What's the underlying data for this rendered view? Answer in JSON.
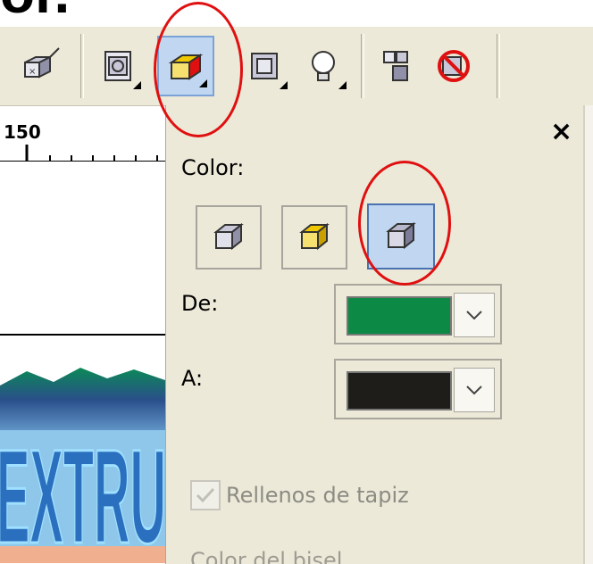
{
  "header": {
    "title_fragment": "or."
  },
  "ruler": {
    "label": "150"
  },
  "canvas": {
    "artwork_text": "EXTRU"
  },
  "toolbar": {
    "buttons": [
      {
        "name": "extrude-vanishing-point",
        "icon": "cube-vanishing-point-icon"
      },
      {
        "name": "extrude-rotation",
        "icon": "cube-rotation-icon"
      },
      {
        "name": "extrude-color",
        "icon": "cube-color-icon",
        "active": true
      },
      {
        "name": "extrude-bevel",
        "icon": "cube-bevel-icon"
      },
      {
        "name": "extrude-lighting",
        "icon": "lightbulb-icon"
      },
      {
        "name": "copy-extrude-properties",
        "icon": "copy-properties-icon"
      },
      {
        "name": "clear-extrude",
        "icon": "clear-extrude-icon"
      }
    ]
  },
  "panel": {
    "close_label": "×",
    "color_label": "Color:",
    "color_modes": [
      {
        "name": "object-fill",
        "icon": "cube-object-fill-icon"
      },
      {
        "name": "solid-fill",
        "icon": "cube-solid-fill-icon"
      },
      {
        "name": "shade",
        "icon": "cube-shade-icon",
        "selected": true
      }
    ],
    "from_label": "De:",
    "from_color": "#0c8a45",
    "to_label": "A:",
    "to_color": "#1f1d1a",
    "checkbox_label": "Rellenos de tapiz",
    "checkbox_checked": true,
    "cut_off_label": "Color del bisel"
  },
  "colors": {
    "annotation_ring": "#e01010",
    "selected_bg": "#c1d6f0"
  }
}
